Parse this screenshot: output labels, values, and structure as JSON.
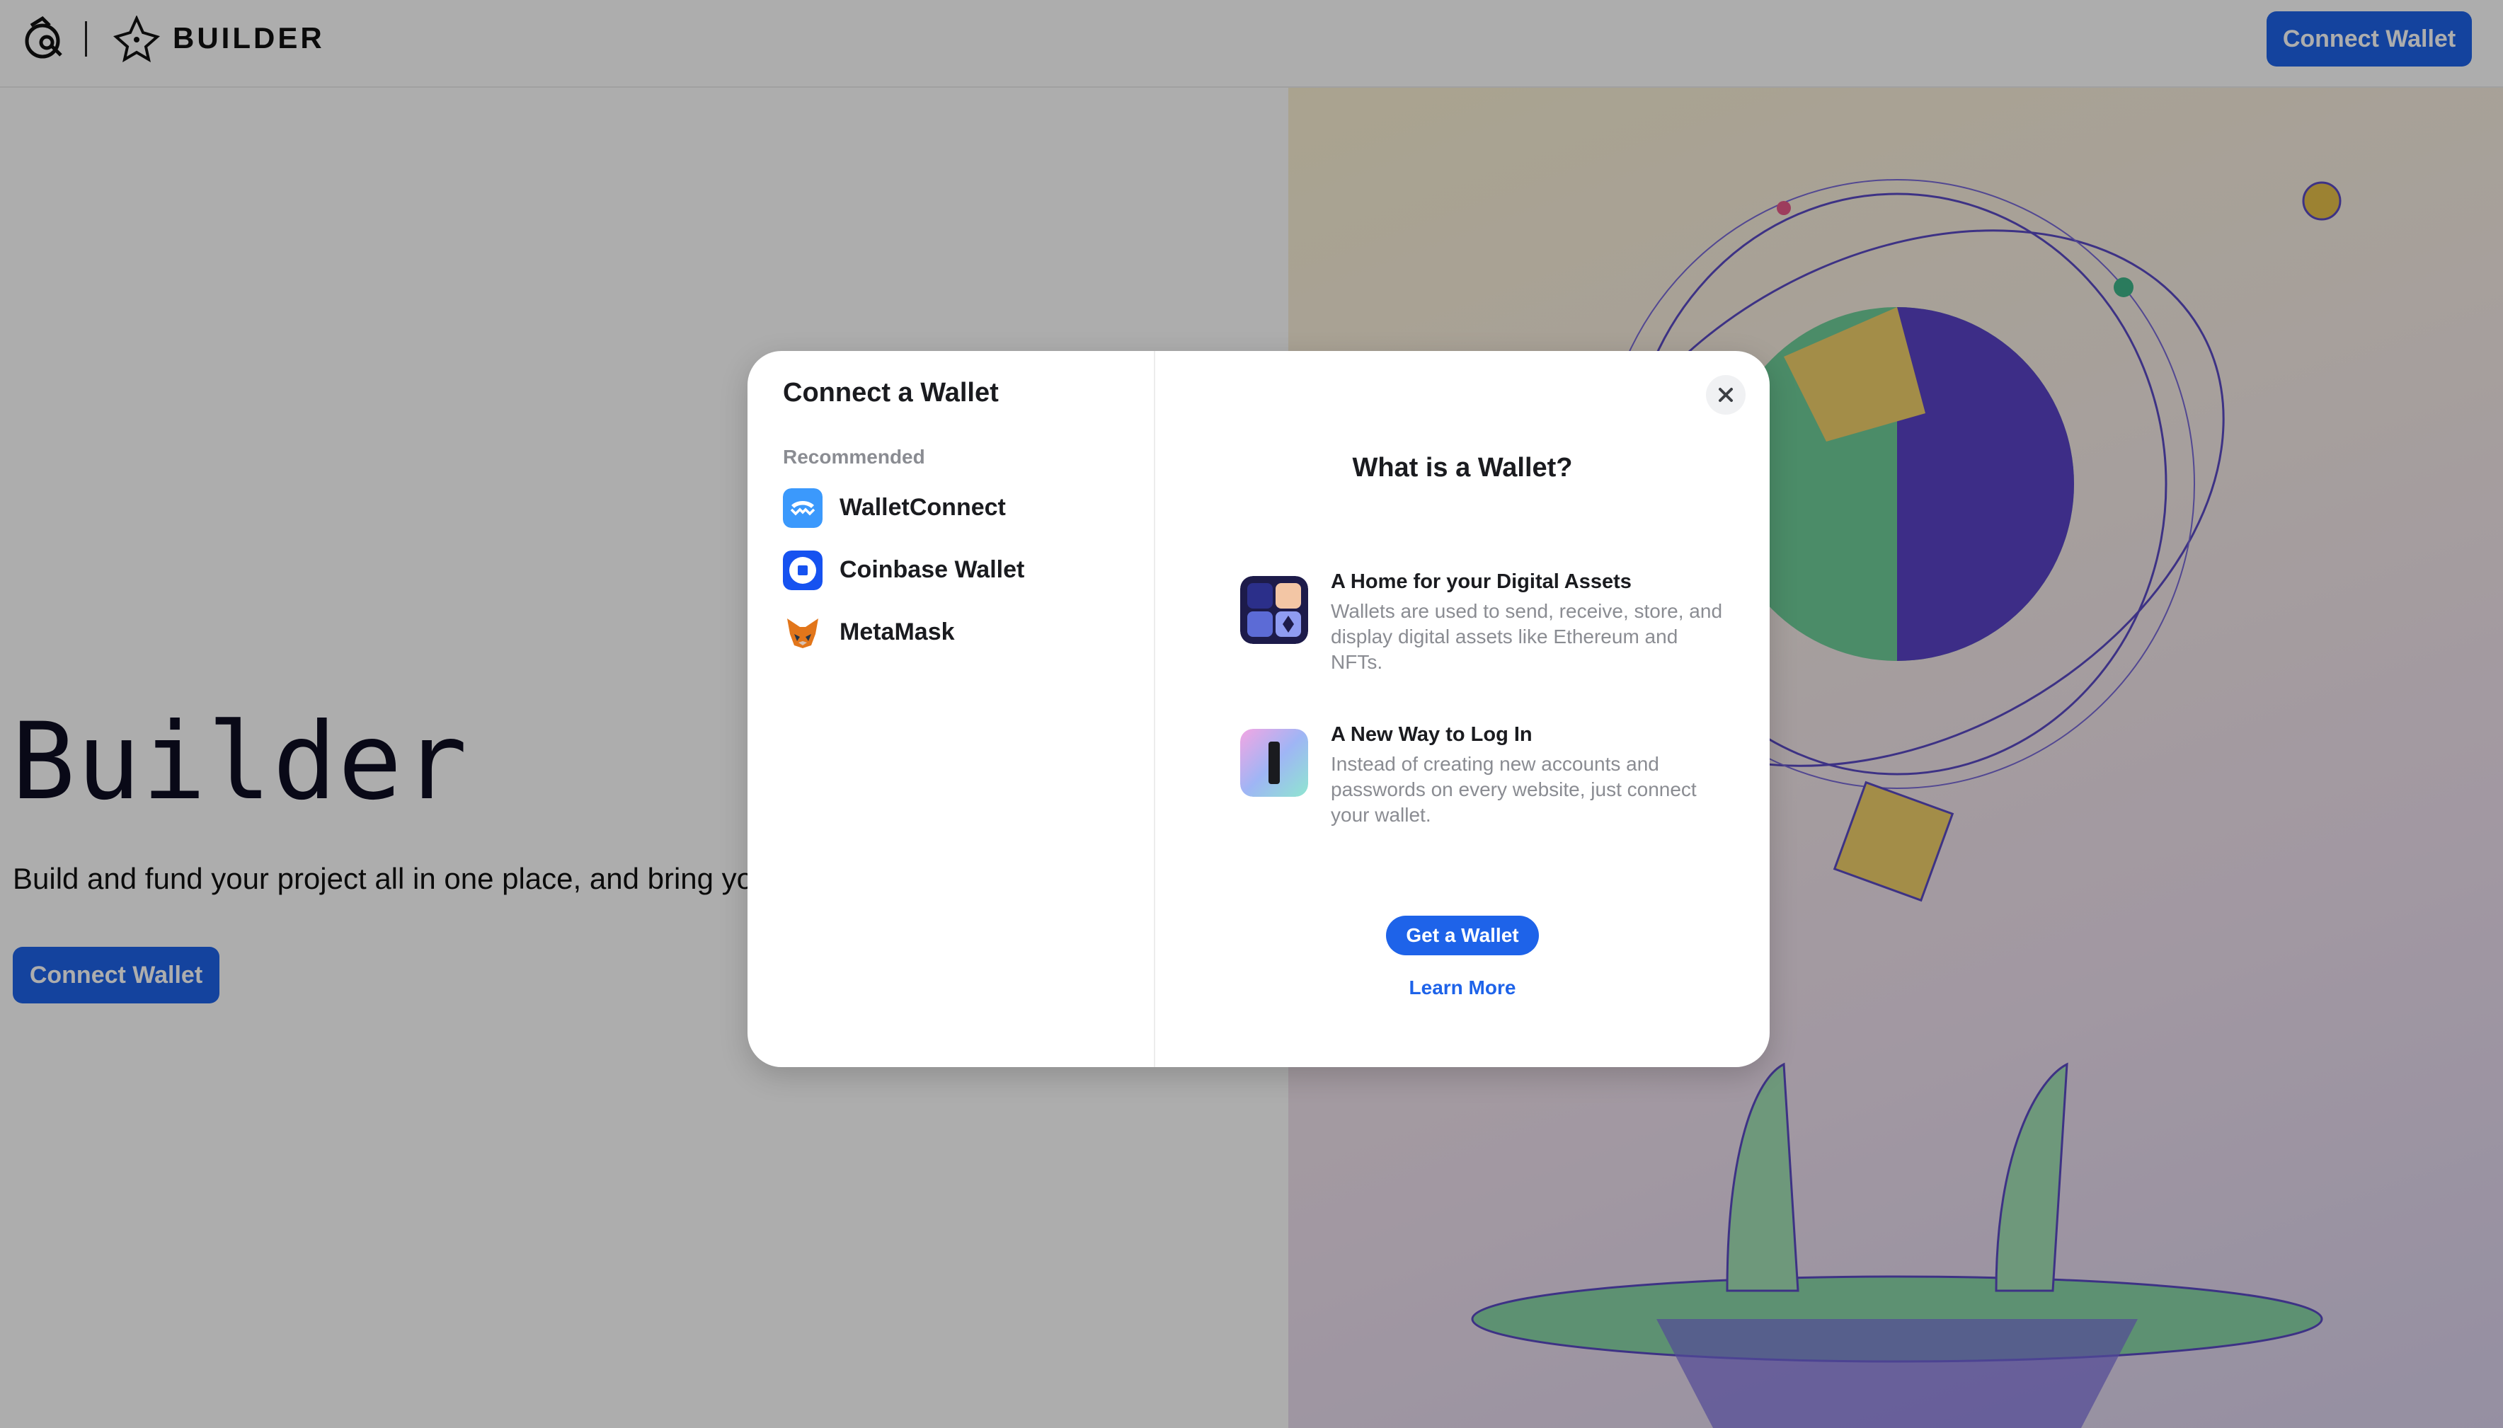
{
  "header": {
    "brand_text": "BUILDER",
    "connect_label": "Connect Wallet"
  },
  "hero": {
    "title": "Builder",
    "subtitle": "Build and fund your project all in one place, and bring you",
    "connect_label": "Connect Wallet"
  },
  "modal": {
    "title": "Connect a Wallet",
    "recommended_label": "Recommended",
    "wallets": [
      {
        "label": "WalletConnect",
        "icon": "walletconnect-icon"
      },
      {
        "label": "Coinbase Wallet",
        "icon": "coinbase-wallet-icon"
      },
      {
        "label": "MetaMask",
        "icon": "metamask-fox-icon"
      }
    ],
    "close_icon": "close-icon",
    "what_title": "What is a Wallet?",
    "info": [
      {
        "title": "A Home for your Digital Assets",
        "text": "Wallets are used to send, receive, store, and display digital assets like Ethereum and NFTs."
      },
      {
        "title": "A New Way to Log In",
        "text": "Instead of creating new accounts and passwords on every website, just connect your wallet."
      }
    ],
    "get_wallet_label": "Get a Wallet",
    "learn_more_label": "Learn More"
  },
  "colors": {
    "accent": "#1e63e9",
    "overlay": "rgba(0,0,0,0.32)"
  }
}
